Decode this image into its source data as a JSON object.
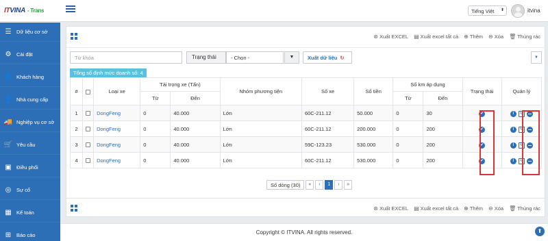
{
  "header": {
    "logo_it": "IT",
    "logo_vina": "VINA",
    "logo_trans": "- Trans",
    "language": "Tiếng Việt",
    "username": "itvina"
  },
  "sidebar": {
    "items": [
      {
        "label": "Dữ liệu cơ sở",
        "icon": "list-icon"
      },
      {
        "label": "Cài đặt",
        "icon": "gear-icon"
      },
      {
        "label": "Khách hàng",
        "icon": "user-icon"
      },
      {
        "label": "Nhà cung cấp",
        "icon": "user-icon"
      },
      {
        "label": "Nghiệp vụ cơ sở",
        "icon": "truck-icon"
      },
      {
        "label": "Yêu cầu",
        "icon": "cart-icon"
      },
      {
        "label": "Điều phối",
        "icon": "cube-icon"
      },
      {
        "label": "Sự cố",
        "icon": "target-icon"
      },
      {
        "label": "Kế toán",
        "icon": "calculator-icon"
      },
      {
        "label": "Báo cáo",
        "icon": "table-icon"
      }
    ]
  },
  "toolbar": {
    "export_excel": "Xuất EXCEL",
    "export_excel_all": "Xuất excel tất cả",
    "add": "Thêm",
    "delete": "Xóa",
    "trash": "Thùng rác"
  },
  "filters": {
    "keyword_placeholder": "Từ khóa",
    "status_label": "Trạng thái",
    "status_value": "- Chọn -",
    "export_data": "Xuất dữ liệu"
  },
  "summary": "Tổng số định mức doanh số: 4",
  "table": {
    "headers": {
      "no": "#",
      "vehicle_type": "Loại xe",
      "load": "Tải trọng xe (Tấn)",
      "from": "Từ",
      "to": "Đến",
      "vehicle_group": "Nhóm phương tiện",
      "plate": "Số xe",
      "amount": "Số tiền",
      "km_applied": "Số km áp dụng",
      "status": "Trạng thái",
      "manage": "Quản lý"
    },
    "rows": [
      {
        "no": "1",
        "type": "DongFeng",
        "load_from": "0",
        "load_to": "40.000",
        "group": "Lớn",
        "plate": "60C-211.12",
        "amount": "50.000",
        "km_from": "0",
        "km_to": "30"
      },
      {
        "no": "2",
        "type": "DongFeng",
        "load_from": "0",
        "load_to": "40.000",
        "group": "Lớn",
        "plate": "60C-211.12",
        "amount": "200.000",
        "km_from": "0",
        "km_to": "200"
      },
      {
        "no": "3",
        "type": "DongFeng",
        "load_from": "0",
        "load_to": "40.000",
        "group": "Lớn",
        "plate": "59C-123.23",
        "amount": "530.000",
        "km_from": "0",
        "km_to": "200"
      },
      {
        "no": "4",
        "type": "DongFeng",
        "load_from": "0",
        "load_to": "40.000",
        "group": "Lớn",
        "plate": "60C-211.12",
        "amount": "530.000",
        "km_from": "0",
        "km_to": "200"
      }
    ]
  },
  "pager": {
    "rows_label": "Số dòng (30)",
    "first": "«",
    "prev": "‹",
    "page": "1",
    "next": "›",
    "last": "»"
  },
  "footer": "Copyright © ITVINA. All rights reserved.",
  "colors": {
    "primary": "#2c6fb6",
    "highlight": "#e03232",
    "badge": "#5bc0de"
  }
}
